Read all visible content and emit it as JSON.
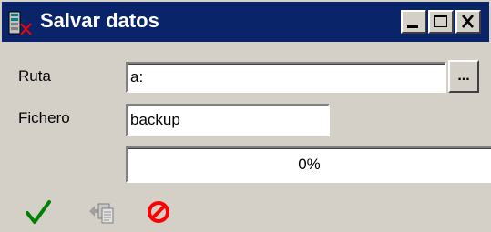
{
  "window": {
    "title": "Salvar datos",
    "title_color": "#0a246a",
    "app_icon": "database-icon"
  },
  "titlebar_buttons": {
    "minimize_icon": "minimize-icon",
    "maximize_icon": "maximize-icon",
    "close_icon": "close-icon"
  },
  "form": {
    "ruta_label": "Ruta",
    "ruta_value": "a:",
    "browse_label": "...",
    "fichero_label": "Fichero",
    "fichero_value": "backup"
  },
  "progress": {
    "value": 0,
    "text": "0%"
  },
  "toolbar": {
    "accept_icon": "checkmark-icon",
    "accept_color": "#008000",
    "export_icon": "copy-document-icon",
    "cancel_icon": "prohibited-icon",
    "cancel_color": "#ff0000"
  }
}
